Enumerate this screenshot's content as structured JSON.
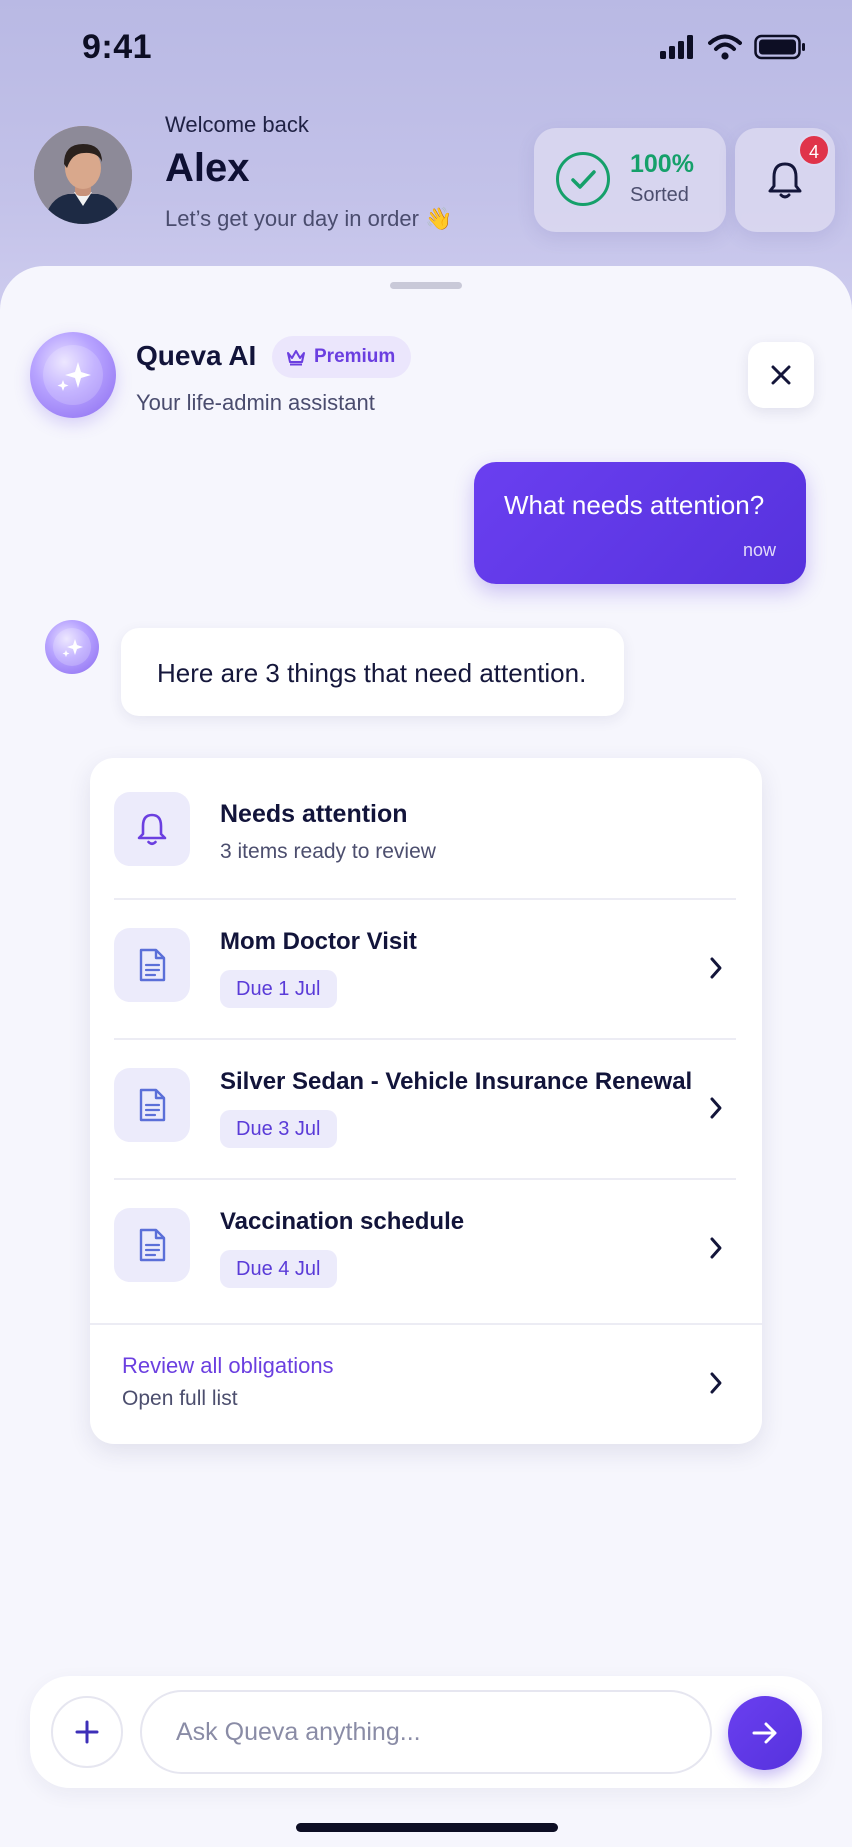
{
  "status_bar": {
    "time": "9:41",
    "icons": [
      "signal-icon",
      "wifi-icon",
      "battery-icon"
    ]
  },
  "header": {
    "welcome": "Welcome back",
    "name": "Alex",
    "tagline": "Let’s get your day in order 👋",
    "sorted": {
      "percent": "100%",
      "label": "Sorted"
    },
    "notifications": {
      "count": "4"
    }
  },
  "assistant": {
    "name": "Queva AI",
    "badge": "Premium",
    "subtitle": "Your life-admin assistant"
  },
  "messages": {
    "user": {
      "text": "What needs attention?",
      "time": "now"
    },
    "ai": {
      "text": "Here are 3 things that need attention."
    }
  },
  "attention_card": {
    "title": "Needs attention",
    "subtitle": "3 items ready to review",
    "items": [
      {
        "title": "Mom Doctor Visit",
        "due": "Due 1 Jul"
      },
      {
        "title": "Silver Sedan - Vehicle Insurance Renewal",
        "due": "Due 3 Jul"
      },
      {
        "title": "Vaccination schedule",
        "due": "Due 4 Jul"
      }
    ],
    "footer": {
      "link": "Review all obligations",
      "sub": "Open full list"
    }
  },
  "composer": {
    "placeholder": "Ask Queva anything..."
  },
  "colors": {
    "accent": "#6a3ff0",
    "success": "#15a06a",
    "badge": "#e0334a"
  }
}
